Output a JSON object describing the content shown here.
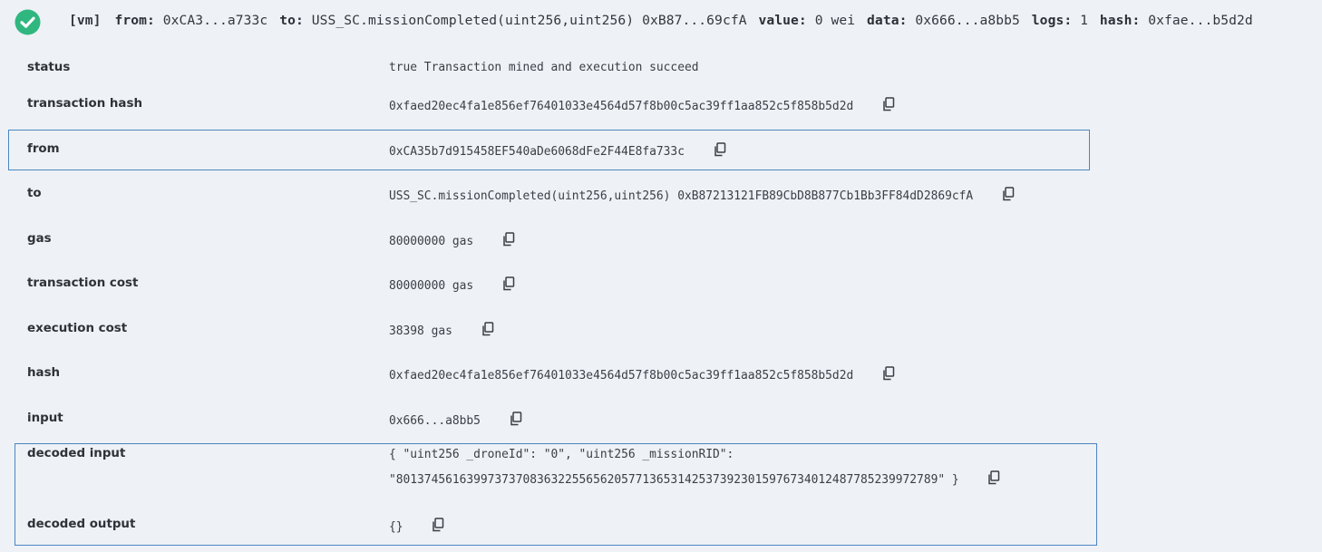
{
  "header": {
    "tag": "[vm]",
    "from_key": "from:",
    "from_val": "0xCA3...a733c",
    "to_key": "to:",
    "to_val": "USS_SC.missionCompleted(uint256,uint256) 0xB87...69cfA",
    "value_key": "value:",
    "value_val": "0 wei",
    "data_key": "data:",
    "data_val": "0x666...a8bb5",
    "logs_key": "logs:",
    "logs_val": "1",
    "hash_key": "hash:",
    "hash_val": "0xfae...b5d2d",
    "status_icon": "check-circle-icon",
    "status_color": "#2fb77f"
  },
  "rows": {
    "status": {
      "label": "status",
      "value": "true Transaction mined and execution succeed"
    },
    "transaction_hash": {
      "label": "transaction hash",
      "value": "0xfaed20ec4fa1e856ef76401033e4564d57f8b00c5ac39ff1aa852c5f858b5d2d"
    },
    "from": {
      "label": "from",
      "value": "0xCA35b7d915458EF540aDe6068dFe2F44E8fa733c"
    },
    "to": {
      "label": "to",
      "value": "USS_SC.missionCompleted(uint256,uint256) 0xB87213121FB89CbD8B877Cb1Bb3FF84dD2869cfA"
    },
    "gas": {
      "label": "gas",
      "value": "80000000 gas"
    },
    "transaction_cost": {
      "label": "transaction cost",
      "value": "80000000 gas"
    },
    "execution_cost": {
      "label": "execution cost",
      "value": "38398 gas"
    },
    "hash": {
      "label": "hash",
      "value": "0xfaed20ec4fa1e856ef76401033e4564d57f8b00c5ac39ff1aa852c5f858b5d2d"
    },
    "input": {
      "label": "input",
      "value": "0x666...a8bb5"
    },
    "decoded_input": {
      "label": "decoded input",
      "line1": "{ \"uint256 _droneId\": \"0\", \"uint256 _missionRID\":",
      "line2": "\"80137456163997373708363225565620577136531425373923015976734012487785239972789\" }"
    },
    "decoded_output": {
      "label": "decoded output",
      "value": "{}"
    }
  },
  "colors": {
    "highlight_border": "#4b86c0",
    "background": "#eef1f6"
  }
}
